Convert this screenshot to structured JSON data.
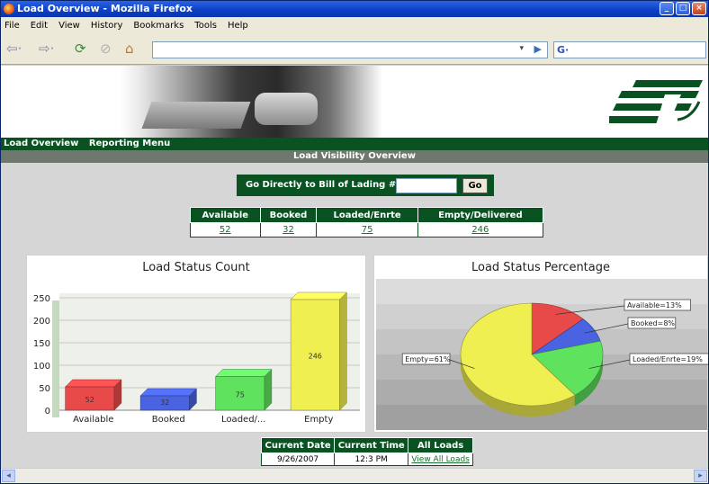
{
  "window": {
    "title": "Load Overview - Mozilla Firefox"
  },
  "menu": [
    "File",
    "Edit",
    "View",
    "History",
    "Bookmarks",
    "Tools",
    "Help"
  ],
  "toolbar": {
    "search_engine_label": "G·"
  },
  "nav": {
    "items": [
      "Load Overview",
      "Reporting Menu"
    ]
  },
  "section": {
    "title": "Load Visibility Overview"
  },
  "bol": {
    "label": "Go Directly to Bill of Lading #:",
    "button": "Go"
  },
  "counts": {
    "headers": [
      "Available",
      "Booked",
      "Loaded/Enrte",
      "Empty/Delivered"
    ],
    "values": [
      "52",
      "32",
      "75",
      "246"
    ]
  },
  "bar_panel": {
    "title": "Load Status Count"
  },
  "pie_panel": {
    "title": "Load Status Percentage"
  },
  "chart_data": [
    {
      "type": "bar",
      "title": "Load Status Count",
      "categories": [
        "Available",
        "Booked",
        "Loaded/...",
        "Empty"
      ],
      "values": [
        52,
        32,
        75,
        246
      ],
      "data_labels": [
        "52",
        "32",
        "75",
        "246"
      ],
      "colors": [
        "#e84a4a",
        "#4a63e0",
        "#5fe35f",
        "#f0ef52"
      ],
      "y_ticks": [
        "0",
        "50",
        "100",
        "150",
        "200",
        "250"
      ],
      "ylim": [
        0,
        260
      ],
      "grid": true
    },
    {
      "type": "pie",
      "title": "Load Status Percentage",
      "labels": [
        "Available=13%",
        "Booked=8%",
        "Loaded/Enrte=19%",
        "Empty=61%"
      ],
      "values": [
        13,
        8,
        19,
        61
      ],
      "colors": [
        "#e84a4a",
        "#4a63e0",
        "#5fe35f",
        "#f0ef52"
      ]
    }
  ],
  "bottom": {
    "headers": [
      "Current Date",
      "Current Time",
      "All Loads"
    ],
    "date": "9/26/2007",
    "time": "12:3 PM",
    "link": "View All Loads"
  },
  "colors": {
    "accent_green": "#0b5223",
    "section_gray": "#6e786e"
  }
}
